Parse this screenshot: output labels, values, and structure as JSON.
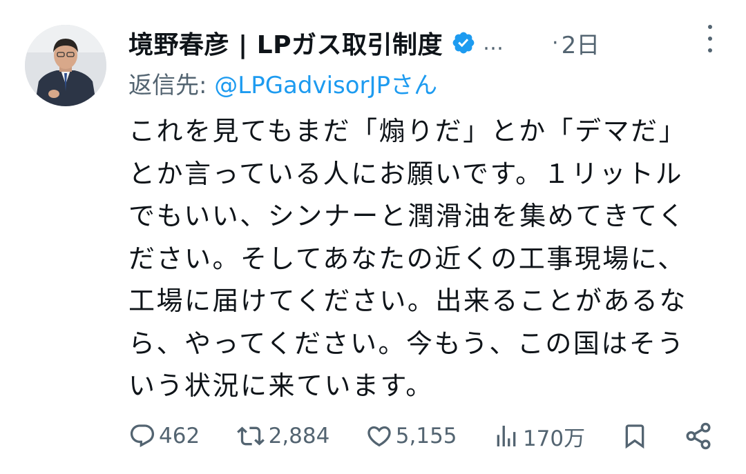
{
  "author": {
    "display_name": "境野春彦 | LPガス取引制度",
    "handle_truncated": "…",
    "verified": true
  },
  "timestamp": "2日",
  "reply_to": {
    "prefix": "返信先: ",
    "handle": "@LPGadvisorJPさん"
  },
  "tweet": {
    "text": "これを見てもまだ「煽りだ」とか「デマだ」とか言っている人にお願いです。１リットルでもいい、シンナーと潤滑油を集めてきてください。そしてあなたの近くの工事現場に、工場に届けてください。出来ることがあるなら、やってください。今もう、この国はそういう状況に来ています。"
  },
  "actions": {
    "replies": "462",
    "reposts": "2,884",
    "likes": "5,155",
    "views": "170万"
  },
  "colors": {
    "text_primary": "#0f1419",
    "text_secondary": "#536471",
    "link": "#1d9bf0",
    "verified_badge": "#1d9bf0"
  }
}
